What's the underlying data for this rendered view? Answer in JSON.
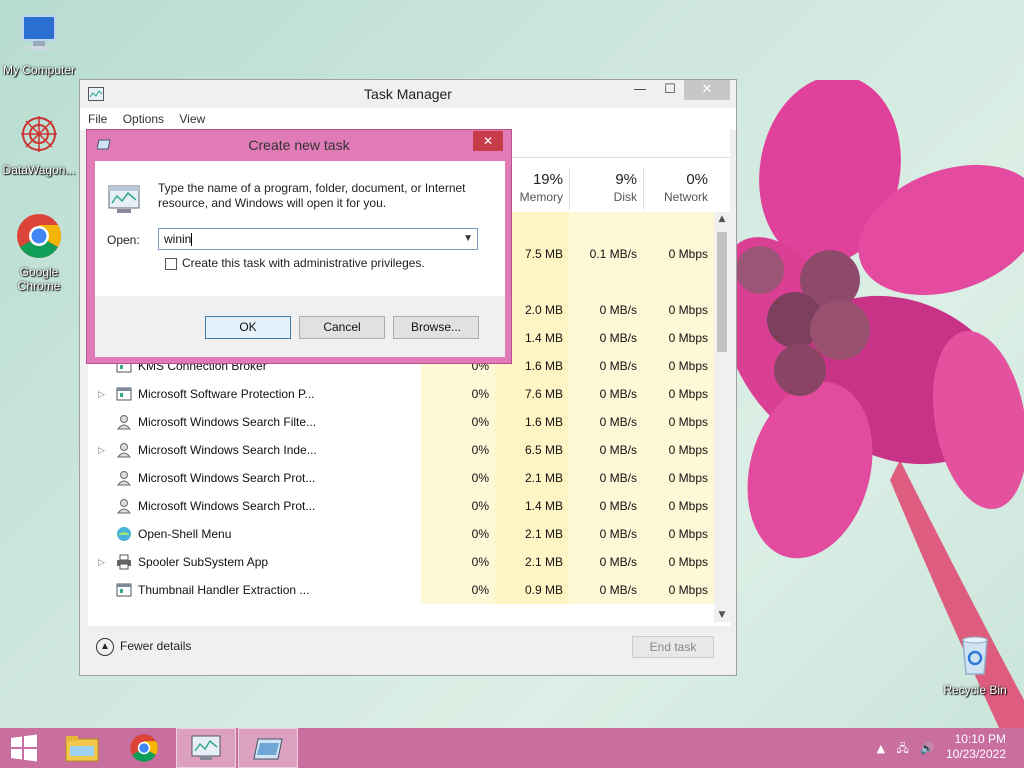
{
  "desktop": {
    "icons": [
      {
        "label": "My Computer"
      },
      {
        "label": "DataWagon..."
      },
      {
        "label": "Google Chrome"
      },
      {
        "label": "Recycle Bin"
      }
    ]
  },
  "task_manager": {
    "title": "Task Manager",
    "controls": {
      "minimize": "—",
      "maximize": "☐",
      "close": "✕"
    },
    "menu": [
      "File",
      "Options",
      "View"
    ],
    "columns": [
      {
        "pct": "19%",
        "label": "Memory"
      },
      {
        "pct": "9%",
        "label": "Disk"
      },
      {
        "pct": "0%",
        "label": "Network"
      }
    ],
    "rows": [
      {
        "name": "",
        "expander": "",
        "cpu": "",
        "mem": "",
        "disk": "",
        "net": "",
        "icon": ""
      },
      {
        "name": "",
        "expander": "",
        "cpu": "",
        "mem": "7.5 MB",
        "disk": "0.1 MB/s",
        "net": "0 Mbps",
        "icon": ""
      },
      {
        "name": "",
        "expander": "",
        "cpu": "",
        "mem": "",
        "disk": "",
        "net": "",
        "icon": ""
      },
      {
        "name": "",
        "expander": "",
        "cpu": "",
        "mem": "2.0 MB",
        "disk": "0 MB/s",
        "net": "0 Mbps",
        "icon": ""
      },
      {
        "name": "",
        "expander": "",
        "cpu": "",
        "mem": "1.4 MB",
        "disk": "0 MB/s",
        "net": "0 Mbps",
        "icon": ""
      },
      {
        "name": "KMS Connection Broker",
        "expander": "",
        "cpu": "0%",
        "mem": "1.6 MB",
        "disk": "0 MB/s",
        "net": "0 Mbps",
        "icon": "window-icon"
      },
      {
        "name": "Microsoft Software Protection P...",
        "expander": "▷",
        "cpu": "0%",
        "mem": "7.6 MB",
        "disk": "0 MB/s",
        "net": "0 Mbps",
        "icon": "window-icon"
      },
      {
        "name": "Microsoft Windows Search Filte...",
        "expander": "",
        "cpu": "0%",
        "mem": "1.6 MB",
        "disk": "0 MB/s",
        "net": "0 Mbps",
        "icon": "user-icon"
      },
      {
        "name": "Microsoft Windows Search Inde...",
        "expander": "▷",
        "cpu": "0%",
        "mem": "6.5 MB",
        "disk": "0 MB/s",
        "net": "0 Mbps",
        "icon": "user-icon"
      },
      {
        "name": "Microsoft Windows Search Prot...",
        "expander": "",
        "cpu": "0%",
        "mem": "2.1 MB",
        "disk": "0 MB/s",
        "net": "0 Mbps",
        "icon": "user-icon"
      },
      {
        "name": "Microsoft Windows Search Prot...",
        "expander": "",
        "cpu": "0%",
        "mem": "1.4 MB",
        "disk": "0 MB/s",
        "net": "0 Mbps",
        "icon": "user-icon"
      },
      {
        "name": "Open-Shell Menu",
        "expander": "",
        "cpu": "0%",
        "mem": "2.1 MB",
        "disk": "0 MB/s",
        "net": "0 Mbps",
        "icon": "shell-icon"
      },
      {
        "name": "Spooler SubSystem App",
        "expander": "▷",
        "cpu": "0%",
        "mem": "2.1 MB",
        "disk": "0 MB/s",
        "net": "0 Mbps",
        "icon": "printer-icon"
      },
      {
        "name": "Thumbnail Handler Extraction ...",
        "expander": "",
        "cpu": "0%",
        "mem": "0.9 MB",
        "disk": "0 MB/s",
        "net": "0 Mbps",
        "icon": "window-icon"
      }
    ],
    "footer": {
      "fewer_details": "Fewer details",
      "end_task": "End task"
    }
  },
  "dialog": {
    "title": "Create new task",
    "close": "✕",
    "description": "Type the name of a program, folder, document, or Internet resource, and Windows will open it for you.",
    "open_label": "Open:",
    "open_value": "winin",
    "checkbox_label": "Create this task with administrative privileges.",
    "buttons": {
      "ok": "OK",
      "cancel": "Cancel",
      "browse": "Browse..."
    }
  },
  "taskbar": {
    "time": "10:10 PM",
    "date": "10/23/2022",
    "tray_up": "▲"
  },
  "colors": {
    "accent": "#e07bb8",
    "taskbar": "#c96f9f",
    "close_red": "#c73b4a"
  }
}
